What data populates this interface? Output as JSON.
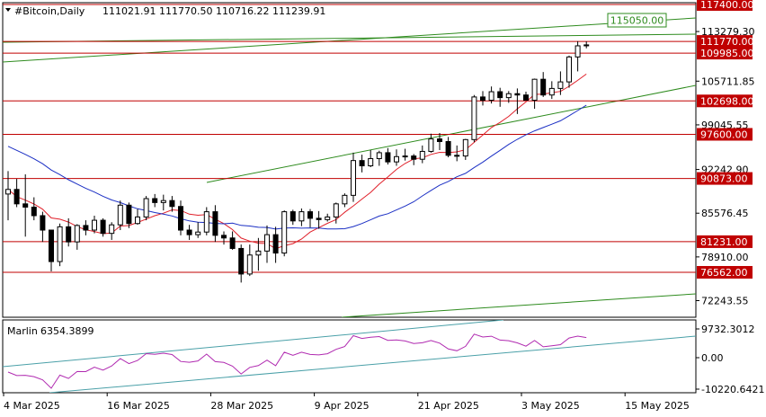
{
  "header": {
    "symbol": "#Bitcoin,Daily",
    "ohlc": "111021.91 111770.50 110716.22 111239.91"
  },
  "colors": {
    "candle": "#000000",
    "hline": "#c00000",
    "channel": "#2e8b1e",
    "ma_red": "#e0202a",
    "ma_blue": "#1b2fc4",
    "oscillator": "#b02ab0",
    "osc_channel": "#4aa0a8",
    "grid": "#c8c8c8"
  },
  "price_axis": {
    "ticks": [
      "113279.30",
      "105711.85",
      "99045.55",
      "92242.90",
      "85576.45",
      "78910.00",
      "72243.55"
    ]
  },
  "levels": [
    {
      "value": 117400.0,
      "label": "117400.00",
      "kind": "red"
    },
    {
      "value": 111770.0,
      "label": "111770.00",
      "kind": "red"
    },
    {
      "value": 109985.0,
      "label": "109985.00",
      "kind": "red"
    },
    {
      "value": 102698.0,
      "label": "102698.00",
      "kind": "red"
    },
    {
      "value": 97600.0,
      "label": "97600.00",
      "kind": "red"
    },
    {
      "value": 90873.0,
      "label": "90873.00",
      "kind": "red"
    },
    {
      "value": 81231.0,
      "label": "81231.00",
      "kind": "red"
    },
    {
      "value": 76562.0,
      "label": "76562.00",
      "kind": "red"
    }
  ],
  "channel_label": "115050.00",
  "indicator": {
    "name": "Marlin",
    "value": "6354.3899",
    "ticks": [
      "9732.3012",
      "0.00",
      "-10220.6421"
    ]
  },
  "time_axis": {
    "labels": [
      "4 Mar 2025",
      "16 Mar 2025",
      "28 Mar 2025",
      "9 Apr 2025",
      "21 Apr 2025",
      "3 May 2025",
      "15 May 2025"
    ]
  },
  "chart_data": {
    "type": "candlestick",
    "start_date": "2025-03-04",
    "ohlc": [
      [
        88500,
        92000,
        84500,
        89200
      ],
      [
        89200,
        90800,
        86500,
        87000
      ],
      [
        87000,
        91500,
        82000,
        86500
      ],
      [
        86500,
        88000,
        84500,
        85200
      ],
      [
        85200,
        85800,
        81200,
        83000
      ],
      [
        83000,
        82500,
        76700,
        78200
      ],
      [
        78200,
        84000,
        77500,
        83500
      ],
      [
        83500,
        84800,
        80500,
        81200
      ],
      [
        81200,
        83900,
        80000,
        83700
      ],
      [
        83700,
        84500,
        82200,
        83000
      ],
      [
        83000,
        85200,
        82500,
        84500
      ],
      [
        84500,
        84800,
        82000,
        82500
      ],
      [
        82500,
        84200,
        81500,
        83800
      ],
      [
        83800,
        87500,
        83000,
        86800
      ],
      [
        86800,
        87200,
        83300,
        84000
      ],
      [
        84000,
        86200,
        83800,
        85000
      ],
      [
        85000,
        88200,
        84500,
        87800
      ],
      [
        87800,
        88500,
        86500,
        87200
      ],
      [
        87200,
        88400,
        86000,
        87500
      ],
      [
        87500,
        88200,
        85800,
        86600
      ],
      [
        86600,
        87500,
        82200,
        83000
      ],
      [
        83000,
        83800,
        81500,
        82300
      ],
      [
        82300,
        84200,
        81800,
        82700
      ],
      [
        82700,
        86500,
        82200,
        85800
      ],
      [
        85800,
        86800,
        81200,
        82200
      ],
      [
        82200,
        82800,
        80800,
        81800
      ],
      [
        81800,
        82800,
        80000,
        80200
      ],
      [
        80200,
        80800,
        75000,
        76300
      ],
      [
        76300,
        80800,
        76000,
        79200
      ],
      [
        79200,
        81800,
        76800,
        79800
      ],
      [
        79800,
        83700,
        78000,
        82300
      ],
      [
        82300,
        83500,
        78000,
        79500
      ],
      [
        79500,
        86000,
        79000,
        85800
      ],
      [
        85800,
        86100,
        83800,
        84400
      ],
      [
        84400,
        86300,
        83600,
        85800
      ],
      [
        85800,
        86200,
        83400,
        84800
      ],
      [
        84800,
        85900,
        83200,
        84600
      ],
      [
        84600,
        85500,
        84300,
        85000
      ],
      [
        85000,
        87200,
        84000,
        87000
      ],
      [
        87000,
        88600,
        86500,
        88300
      ],
      [
        88300,
        94800,
        87300,
        93600
      ],
      [
        93600,
        94500,
        91800,
        92800
      ],
      [
        92800,
        95200,
        92600,
        93900
      ],
      [
        93900,
        95100,
        92800,
        94800
      ],
      [
        94800,
        95500,
        93000,
        93400
      ],
      [
        93400,
        95300,
        92800,
        94200
      ],
      [
        94200,
        95400,
        93600,
        94300
      ],
      [
        94300,
        94600,
        92900,
        93800
      ],
      [
        93800,
        95900,
        93200,
        95000
      ],
      [
        95000,
        97700,
        94800,
        96900
      ],
      [
        96900,
        97800,
        95200,
        96500
      ],
      [
        96500,
        97200,
        94100,
        94400
      ],
      [
        94400,
        95900,
        93500,
        94300
      ],
      [
        94300,
        96900,
        93700,
        96800
      ],
      [
        96800,
        103600,
        96400,
        103300
      ],
      [
        103300,
        104200,
        102000,
        102800
      ],
      [
        102800,
        104900,
        102300,
        104100
      ],
      [
        104100,
        104700,
        101800,
        103200
      ],
      [
        103200,
        104200,
        102400,
        103800
      ],
      [
        103800,
        104600,
        100700,
        103600
      ],
      [
        103600,
        104100,
        102800,
        102800
      ],
      [
        102800,
        106100,
        101500,
        106000
      ],
      [
        106000,
        107100,
        103300,
        103600
      ],
      [
        103600,
        105700,
        103000,
        104600
      ],
      [
        104600,
        107200,
        103600,
        105600
      ],
      [
        105600,
        109600,
        104700,
        109400
      ],
      [
        109400,
        111800,
        107200,
        111100
      ],
      [
        111100,
        111770,
        110716,
        111240
      ]
    ]
  }
}
